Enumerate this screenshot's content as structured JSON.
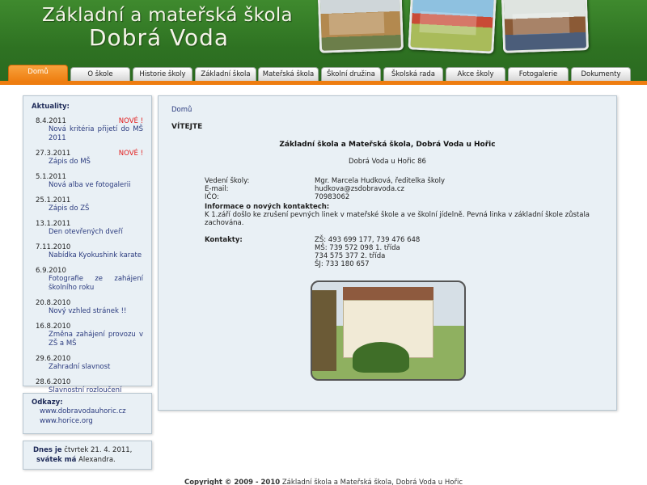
{
  "header": {
    "title_line1": "Základní a mateřská škola",
    "title_line2": "Dobrá Voda"
  },
  "nav": {
    "items": [
      {
        "label": "Domů",
        "active": true
      },
      {
        "label": "O škole"
      },
      {
        "label": "Historie školy"
      },
      {
        "label": "Základní škola"
      },
      {
        "label": "Mateřská škola"
      },
      {
        "label": "Školní družina"
      },
      {
        "label": "Školská rada"
      },
      {
        "label": "Akce školy"
      },
      {
        "label": "Fotogalerie"
      },
      {
        "label": "Dokumenty"
      }
    ],
    "active_color": "#ee7d10"
  },
  "sidebar": {
    "news_heading": "Aktuality:",
    "news": [
      {
        "date": "8.4.2011",
        "badge": "NOVÉ !",
        "title": "Nová kritéria přijetí do MŠ 2011"
      },
      {
        "date": "27.3.2011",
        "badge": "NOVÉ !",
        "title": "Zápis do MŠ"
      },
      {
        "date": "5.1.2011",
        "badge": "",
        "title": "Nová alba ve fotogalerii"
      },
      {
        "date": "25.1.2011",
        "badge": "",
        "title": "Zápis do ZŠ"
      },
      {
        "date": "13.1.2011",
        "badge": "",
        "title": "Den otevřených dveří"
      },
      {
        "date": "7.11.2010",
        "badge": "",
        "title": "Nabídka Kyokushink karate"
      },
      {
        "date": "6.9.2010",
        "badge": "",
        "title": "Fotografie ze zahájení školního roku"
      },
      {
        "date": "20.8.2010",
        "badge": "",
        "title": "Nový vzhled stránek !!"
      },
      {
        "date": "16.8.2010",
        "badge": "",
        "title": "Změna zahájení provozu v ZŠ a MŠ"
      },
      {
        "date": "29.6.2010",
        "badge": "",
        "title": "Zahradní slavnost"
      },
      {
        "date": "28.6.2010",
        "badge": "",
        "title": "Slavnostní rozloučení"
      }
    ],
    "links_heading": "Odkazy:",
    "links": [
      "www.dobravodauhoric.cz",
      "www.horice.org"
    ],
    "today_label": "Dnes je",
    "today_value": "čtvrtek 21. 4. 2011,",
    "nameday_label": "svátek má",
    "nameday_value": "Alexandra."
  },
  "main": {
    "breadcrumb": "Domů",
    "welcome": "VÍTEJTE",
    "school_name": "Základní škola a Mateřská škola, Dobrá Voda u Hořic",
    "address": "Dobrá Voda u Hořic 86",
    "rows": [
      {
        "key": "Vedení školy:",
        "value": "Mgr. Marcela Hudková, ředitelka školy"
      },
      {
        "key": "E-mail:",
        "value": "hudkova@zsdobravoda.cz"
      },
      {
        "key": "IČO:",
        "value": "70983062"
      }
    ],
    "note_heading": "Informace o nových kontaktech:",
    "note_text": "K 1.září došlo ke zrušení pevných linek v mateřské škole a ve školní jídelně. Pevná linka v základní škole zůstala zachována.",
    "contacts_label": "Kontakty:",
    "contacts": [
      "ZŠ: 493 699 177, 739 476 648",
      "MŠ: 739 572 098 1. třída",
      "734 575 377 2. třída",
      "ŠJ: 733 180 657"
    ]
  },
  "footer": {
    "copyright_bold": "Copyright © 2009 - 2010",
    "copyright_text": "Základní škola a Mateřská škola, Dobrá Voda u Hořic"
  }
}
